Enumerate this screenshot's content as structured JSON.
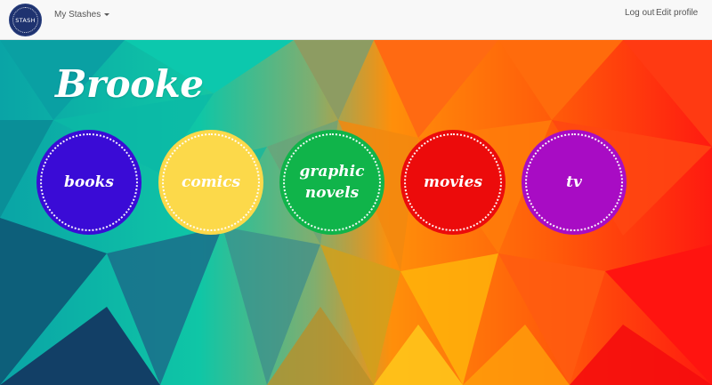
{
  "navbar": {
    "logo_text": "STASH",
    "dropdown_label": "My Stashes",
    "logout_label": "Log out",
    "edit_profile_label": "Edit profile"
  },
  "user": {
    "name": "Brooke"
  },
  "stashes": [
    {
      "label": "books",
      "color": "#3a0bd6"
    },
    {
      "label": "comics",
      "color": "#fcd94a"
    },
    {
      "label": "graphic novels",
      "color": "#10b44a"
    },
    {
      "label": "movies",
      "color": "#ec0b0b"
    },
    {
      "label": "tv",
      "color": "#a80cc4"
    }
  ],
  "colors": {
    "nav_bg": "#f8f8f8",
    "logo_bg": "#1f3370",
    "hero_teal": "#09c9ad",
    "hero_orange": "#ff7a0a",
    "hero_red": "#ff1a1a"
  }
}
